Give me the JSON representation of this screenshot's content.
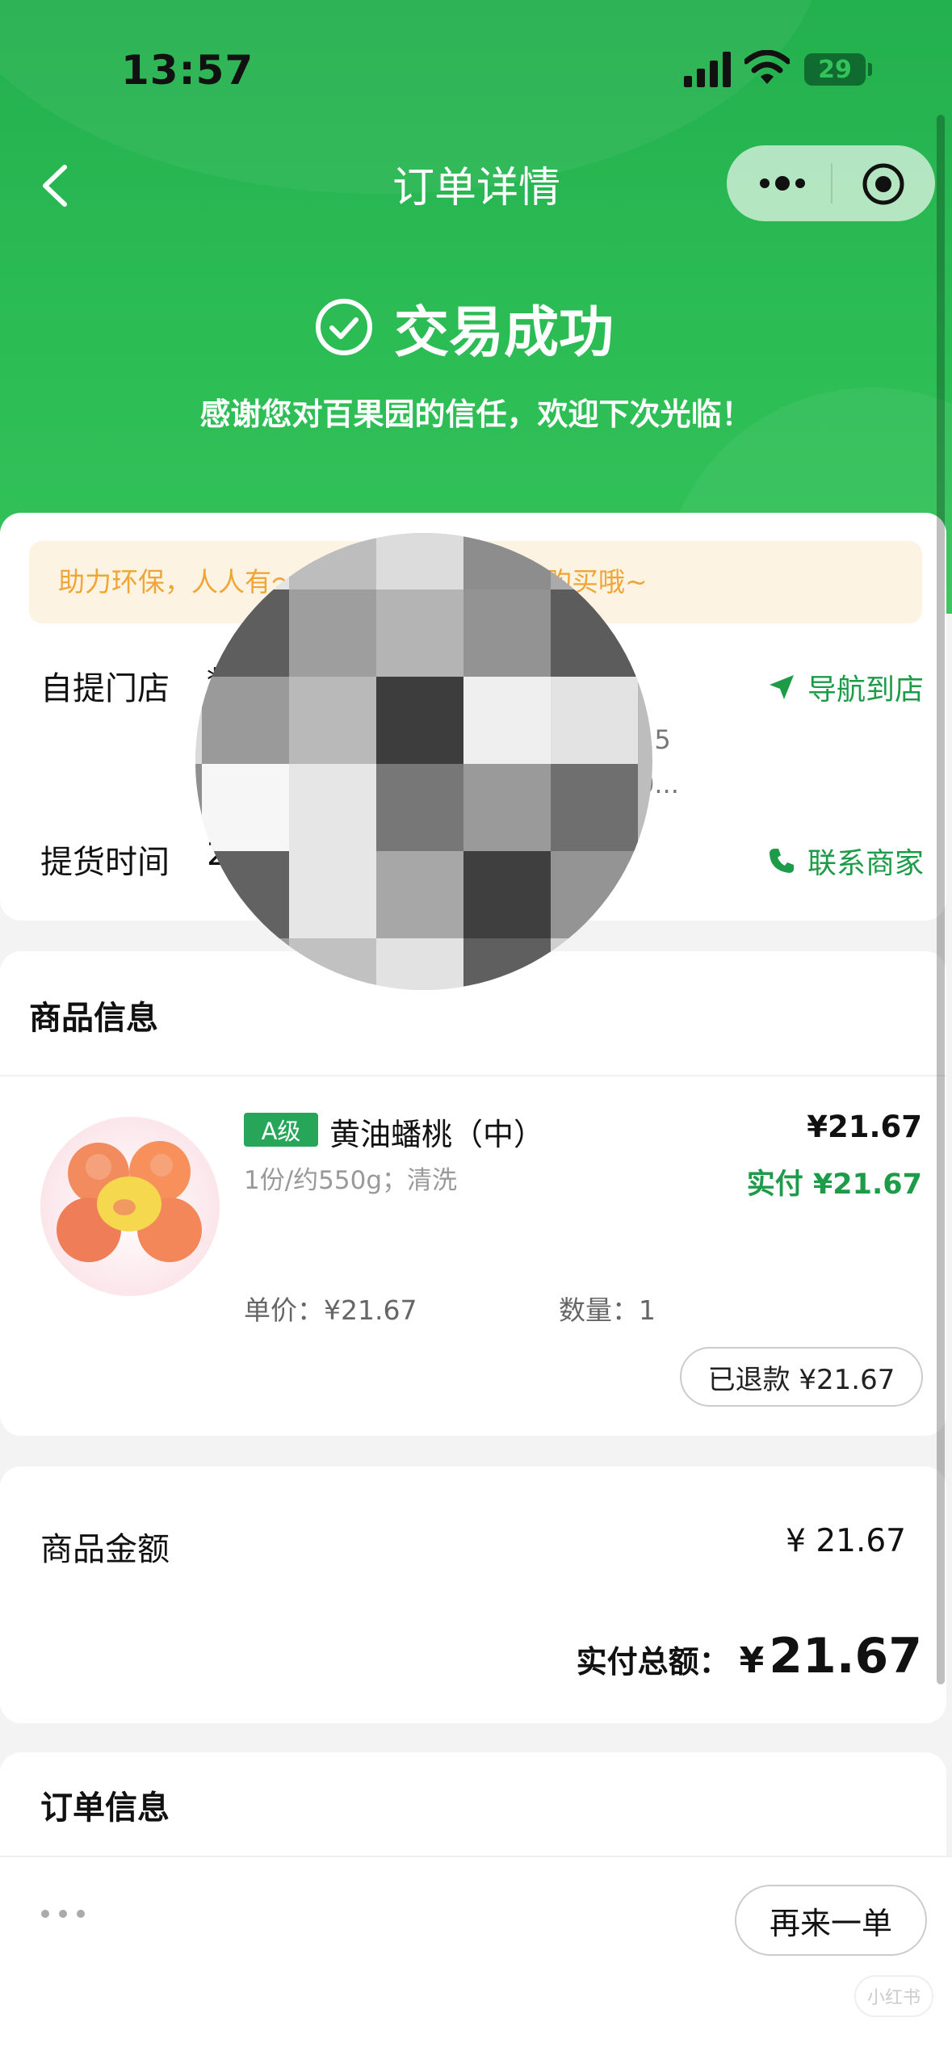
{
  "status_bar": {
    "time": "13:57",
    "battery": "29"
  },
  "nav": {
    "title": "订单详情"
  },
  "order_status": {
    "title": "交易成功",
    "message": "感谢您对百果园的信任，欢迎下次光临！"
  },
  "store": {
    "eco_banner": "助力环保，人人有～ ～ ～ ～ ～袋或到店购买哦~",
    "pickup_store_label": "自提门店",
    "pickup_time_label": "提货时间",
    "store_fragment": "*",
    "time_fragment": "2",
    "address_fragment_1": "15",
    "address_fragment_2": "0...",
    "navigate_label": "导航到店",
    "contact_label": "联系商家"
  },
  "products": {
    "section_title": "商品信息",
    "items": [
      {
        "grade": "A级",
        "name": "黄油蟠桃（中）",
        "spec": "1份/约550g；清洗",
        "price": "¥21.67",
        "paid": "实付 ¥21.67",
        "unit_price": "单价：¥21.67",
        "quantity": "数量：1",
        "refund_label": "已退款 ¥21.67"
      }
    ]
  },
  "summary": {
    "goods_amount_label": "商品金额",
    "goods_amount_value": "¥ 21.67",
    "total_label": "实付总额：",
    "total_currency": "¥",
    "total_value": "21.67"
  },
  "order_info": {
    "section_title": "订单信息"
  },
  "bottom": {
    "reorder_label": "再来一单",
    "watermark": "小红书"
  },
  "colors": {
    "brand_green": "#2dbd55",
    "accent_green": "#1e9b49",
    "banner_orange": "#f0a537"
  }
}
